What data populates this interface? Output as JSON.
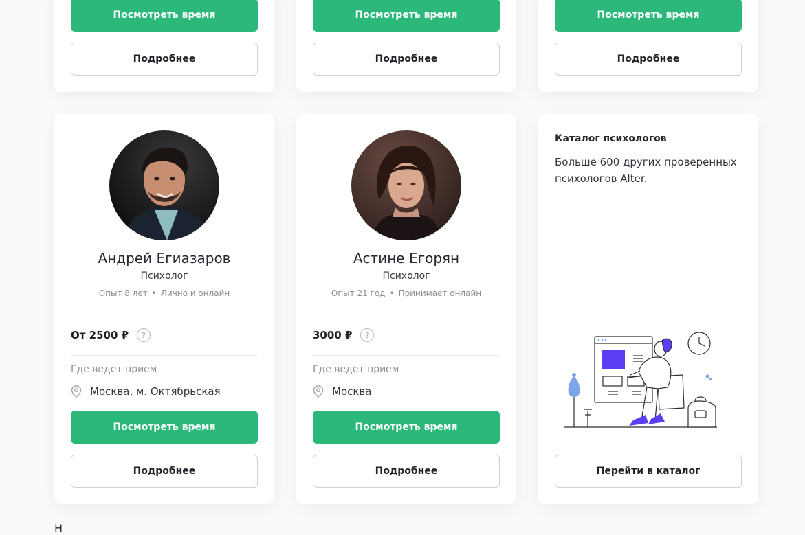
{
  "top_row": [
    {
      "primary_label": "Посмотреть время",
      "secondary_label": "Подробнее"
    },
    {
      "primary_label": "Посмотреть время",
      "secondary_label": "Подробнее"
    },
    {
      "primary_label": "Посмотреть время",
      "secondary_label": "Подробнее"
    }
  ],
  "psychologists": [
    {
      "name": "Андрей Егиазаров",
      "role": "Психолог",
      "experience": "Опыт 8 лет",
      "format": "Лично и онлайн",
      "separator": "•",
      "price": "От 2500 ₽",
      "help": "?",
      "where_label": "Где ведет прием",
      "location": "Москва, м.  Октябрьская",
      "primary_label": "Посмотреть время",
      "secondary_label": "Подробнее"
    },
    {
      "name": "Астине Егорян",
      "role": "Психолог",
      "experience": "Опыт 21 год",
      "format": "Принимает онлайн",
      "separator": "•",
      "price": "3000 ₽",
      "help": "?",
      "where_label": "Где ведет прием",
      "location": "Москва",
      "primary_label": "Посмотреть время",
      "secondary_label": "Подробнее"
    }
  ],
  "catalog": {
    "title": "Каталог психологов",
    "description": "Больше 600 других проверенных психологов Alter.",
    "button_label": "Перейти в каталог"
  },
  "bottom_peek": "Н",
  "colors": {
    "accent_green": "#2bb87a",
    "illustration_purple": "#5b3ff5",
    "illustration_blue": "#7da4e8"
  },
  "icons": [
    "question-circle-icon",
    "location-pin-icon"
  ]
}
